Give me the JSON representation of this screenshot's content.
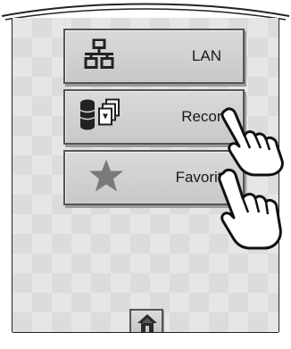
{
  "menu": {
    "items": [
      {
        "label": "LAN",
        "icon": "network-icon"
      },
      {
        "label": "Record",
        "icon": "database-record-icon"
      },
      {
        "label": "Favorite",
        "icon": "star-icon"
      }
    ]
  },
  "footer": {
    "home_icon": "home-icon"
  },
  "colors": {
    "button": "#d0d0d0",
    "border": "#555555",
    "icon": "#333333",
    "star": "#7a7a7a"
  }
}
